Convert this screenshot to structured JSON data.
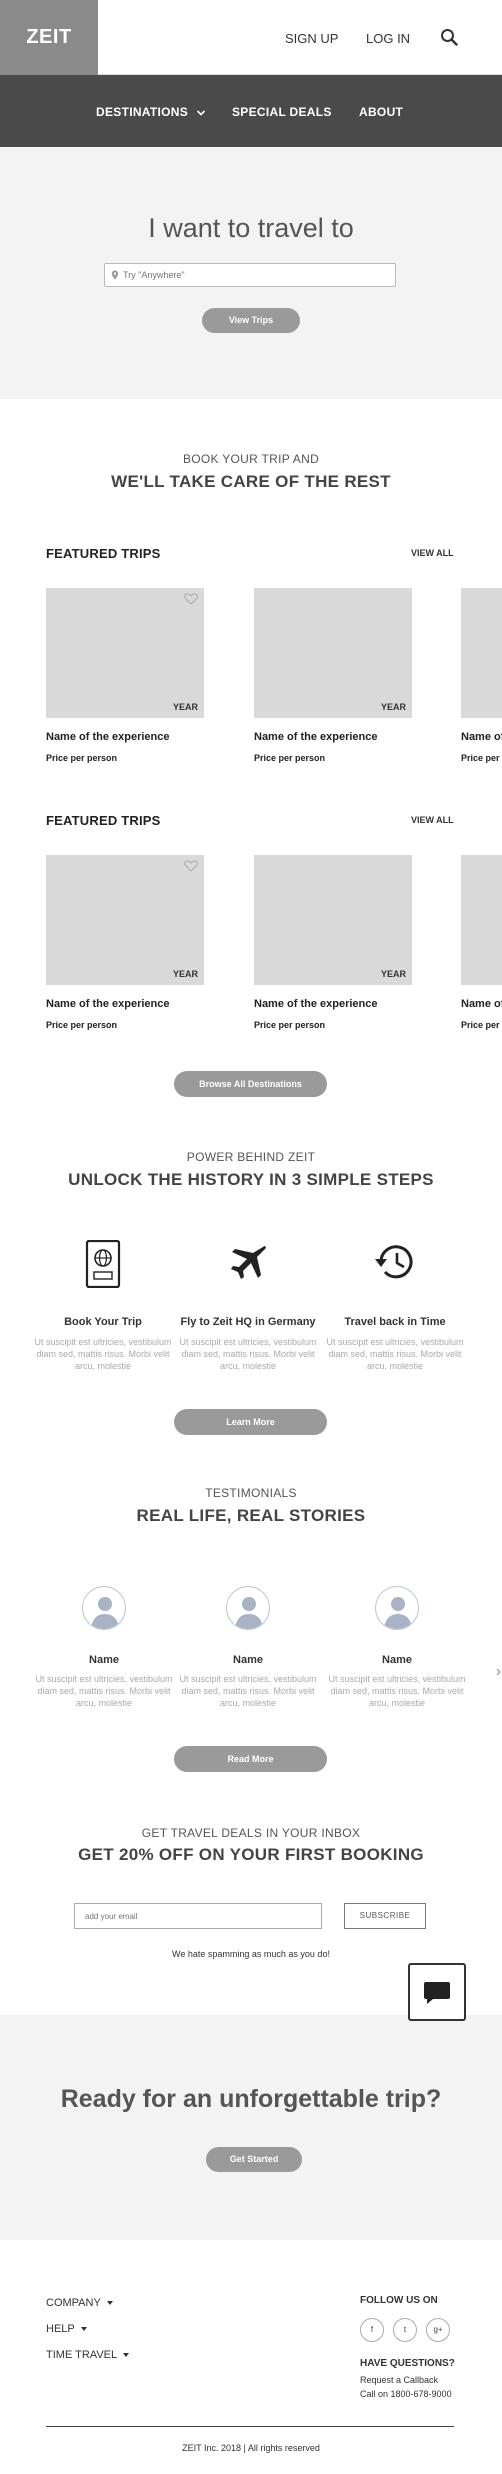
{
  "header": {
    "logo": "ZEIT",
    "signup": "SIGN UP",
    "login": "LOG IN"
  },
  "nav": {
    "destinations": "DESTINATIONS",
    "special_deals": "SPECIAL DEALS",
    "about": "ABOUT"
  },
  "hero": {
    "title": "I want to travel to",
    "search_placeholder": "Try \"Anywhere\"",
    "button": "View Trips"
  },
  "intro": {
    "kicker": "BOOK YOUR TRIP AND",
    "headline": "WE'LL TAKE CARE OF THE REST"
  },
  "featured": [
    {
      "title": "FEATURED TRIPS",
      "view_all": "VIEW ALL",
      "cards": [
        {
          "badge": "YEAR",
          "name": "Name of the experience",
          "price": "Price per person"
        },
        {
          "badge": "YEAR",
          "name": "Name of the experience",
          "price": "Price per person"
        },
        {
          "badge": "",
          "name": "Name of the experience",
          "price": "Price per person"
        }
      ]
    },
    {
      "title": "FEATURED TRIPS",
      "view_all": "VIEW ALL",
      "cards": [
        {
          "badge": "YEAR",
          "name": "Name of the experience",
          "price": "Price per person"
        },
        {
          "badge": "YEAR",
          "name": "Name of the experience",
          "price": "Price per person"
        },
        {
          "badge": "",
          "name": "Name of the experience",
          "price": "Price per person"
        }
      ]
    }
  ],
  "browse_button": "Browse All Destinations",
  "steps_section": {
    "kicker": "POWER BEHIND ZEIT",
    "headline": "UNLOCK THE HISTORY IN 3 SIMPLE STEPS",
    "steps": [
      {
        "icon": "passport-icon",
        "title": "Book Your Trip",
        "desc": "Ut suscipit est ultricies, vestibulum diam sed, mattis risus. Morbi velit arcu, molestie"
      },
      {
        "icon": "airplane-icon",
        "title": "Fly to Zeit HQ in Germany",
        "desc": "Ut suscipit est ultricies, vestibulum diam sed, mattis risus. Morbi velit arcu, molestie"
      },
      {
        "icon": "history-clock-icon",
        "title": "Travel back in Time",
        "desc": "Ut suscipit est ultricies, vestibulum diam sed, mattis risus. Morbi velit arcu, molestie"
      }
    ],
    "button": "Learn More"
  },
  "testimonials": {
    "kicker": "TESTIMONIALS",
    "headline": "REAL LIFE, REAL STORIES",
    "items": [
      {
        "name": "Name",
        "text": "Ut suscipit est ultricies, vestibulum diam sed, mattis risus. Morbi velit arcu, molestie"
      },
      {
        "name": "Name",
        "text": "Ut suscipit est ultricies, vestibulum diam sed, mattis risus. Morbi velit arcu, molestie"
      },
      {
        "name": "Name",
        "text": "Ut suscipit est ultricies, vestibulum diam sed, mattis risus. Morbi velit arcu, molestie"
      }
    ],
    "button": "Read More"
  },
  "newsletter": {
    "kicker": "GET TRAVEL DEALS IN YOUR INBOX",
    "headline": "GET 20% OFF ON YOUR FIRST BOOKING",
    "email_placeholder": "add your email",
    "subscribe": "SUBSCRIBE",
    "note": "We hate spamming as much as you do!"
  },
  "cta": {
    "title": "Ready for an unforgettable trip?",
    "button": "Get Started"
  },
  "footer": {
    "links": [
      "COMPANY",
      "HELP",
      "TIME TRAVEL"
    ],
    "follow": "FOLLOW US ON",
    "social": [
      "f",
      "t",
      "g+"
    ],
    "questions": "HAVE QUESTIONS?",
    "callback": "Request a Callback",
    "phone": "Call on 1800-678-9000",
    "copyright": "ZEIT Inc. 2018 | All rights reserved"
  }
}
